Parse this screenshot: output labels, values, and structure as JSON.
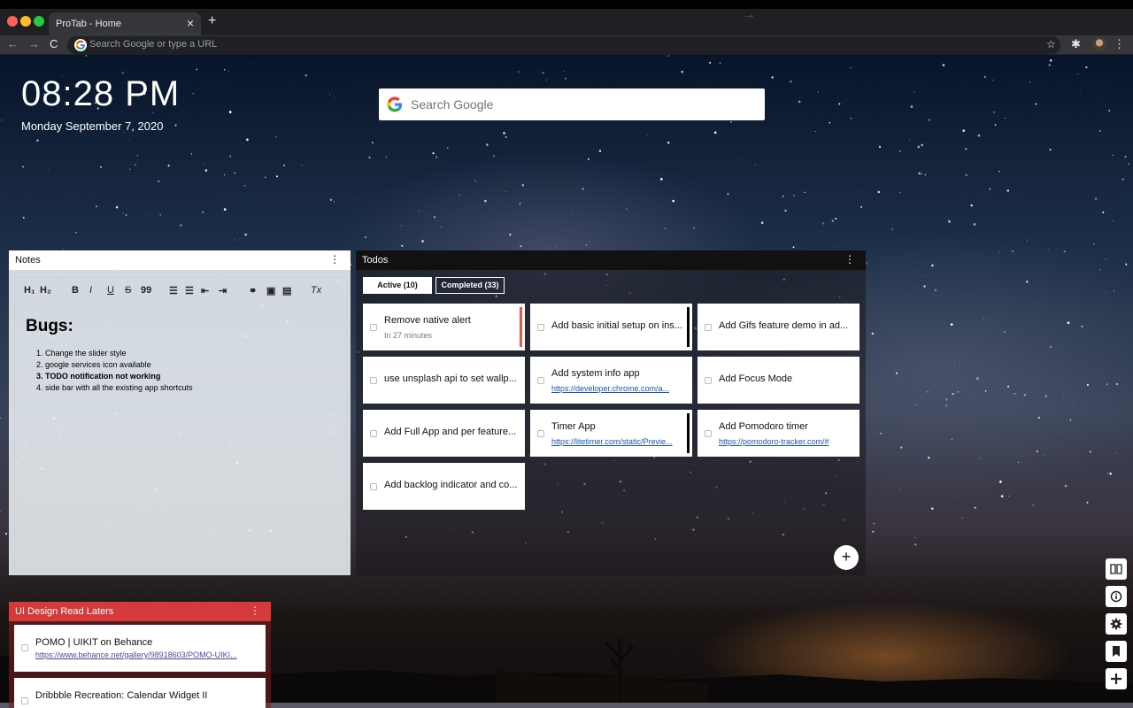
{
  "browser": {
    "tab_title": "ProTab - Home",
    "tab_close": "×",
    "new_tab": "+",
    "omnibox_placeholder": "Search Google or type a URL",
    "nav": {
      "back": "←",
      "forward": "→",
      "reload": "C"
    }
  },
  "clock": {
    "time": "08:28 PM",
    "date": "Monday  September 7, 2020"
  },
  "search": {
    "placeholder": "Search Google",
    "go": "→"
  },
  "notes": {
    "title": "Notes",
    "menu": "⋮",
    "toolbar": [
      "H₁",
      "H₂",
      "B",
      "I",
      "U",
      "S",
      "99",
      "list-ol",
      "list-ul",
      "indent-out",
      "indent-in",
      "link",
      "image",
      "video",
      "Tx"
    ],
    "heading": "Bugs:",
    "items": [
      "Change the slider style",
      "google services icon available",
      "TODO notification not working",
      "side bar with all the existing app shortcuts"
    ]
  },
  "todos": {
    "title": "Todos",
    "menu": "⋮",
    "tabs": {
      "active": "Active (10)",
      "completed": "Completed (33)"
    },
    "add": "+",
    "cards": [
      {
        "title": "Remove native alert",
        "sub": "In 27 minutes",
        "link": "",
        "bar": "#e25c4a"
      },
      {
        "title": "Add basic initial setup on ins...",
        "sub": "",
        "link": "",
        "bar": "#000000"
      },
      {
        "title": "Add Gifs feature demo in ad...",
        "sub": "",
        "link": "",
        "bar": ""
      },
      {
        "title": "use unsplash api to set wallp...",
        "sub": "",
        "link": "",
        "bar": ""
      },
      {
        "title": "Add system info app",
        "sub": "",
        "link": "https://developer.chrome.com/a...",
        "bar": ""
      },
      {
        "title": "Add Focus Mode",
        "sub": "",
        "link": "",
        "bar": ""
      },
      {
        "title": "Add Full App and per feature...",
        "sub": "",
        "link": "",
        "bar": ""
      },
      {
        "title": "Timer App",
        "sub": "",
        "link": "https://litetimer.com/static/Previe...",
        "bar": "#000000"
      },
      {
        "title": "Add Pomodoro timer",
        "sub": "",
        "link": "https://pomodoro-tracker.com/#",
        "bar": ""
      },
      {
        "title": "Add backlog indicator and co...",
        "sub": "",
        "link": "",
        "bar": ""
      }
    ]
  },
  "readlater": {
    "title": "UI Design Read Laters",
    "menu": "⋮",
    "items": [
      {
        "title": "POMO | UIKIT on Behance",
        "link": "https://www.behance.net/gallery/98918603/POMO-UIKI..."
      },
      {
        "title": "Dribbble Recreation: Calendar Widget II",
        "link": ""
      }
    ]
  },
  "dock": [
    "book-icon",
    "info-icon",
    "settings-icon",
    "bookmark-icon",
    "plus-icon"
  ],
  "colors": {
    "readlater_header": "#d43a3a",
    "todo_urgent_bar": "#e25c4a",
    "link_blue": "#1a56c6"
  }
}
